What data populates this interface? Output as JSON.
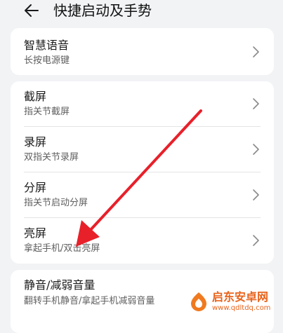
{
  "header": {
    "title": "快捷启动及手势",
    "back_icon": "arrow-left-icon"
  },
  "groups": [
    {
      "items": [
        {
          "title": "智慧语音",
          "subtitle": "长按电源键"
        }
      ]
    },
    {
      "items": [
        {
          "title": "截屏",
          "subtitle": "指关节截屏"
        },
        {
          "title": "录屏",
          "subtitle": "双指关节录屏"
        },
        {
          "title": "分屏",
          "subtitle": "指关节启动分屏"
        },
        {
          "title": "亮屏",
          "subtitle": "拿起手机/双击亮屏"
        }
      ]
    },
    {
      "items": [
        {
          "title": "静音/减弱音量",
          "subtitle": "翻转手机静音/拿起手机减弱音量"
        }
      ]
    }
  ],
  "annotation": {
    "arrow_color": "#e8202a"
  },
  "watermark": {
    "name": "启东安卓网",
    "url": "www.qdltdq.com",
    "color": "#e8641c"
  },
  "colors": {
    "background": "#f1f3f5",
    "card": "#ffffff",
    "divider": "#e4e4e4"
  }
}
